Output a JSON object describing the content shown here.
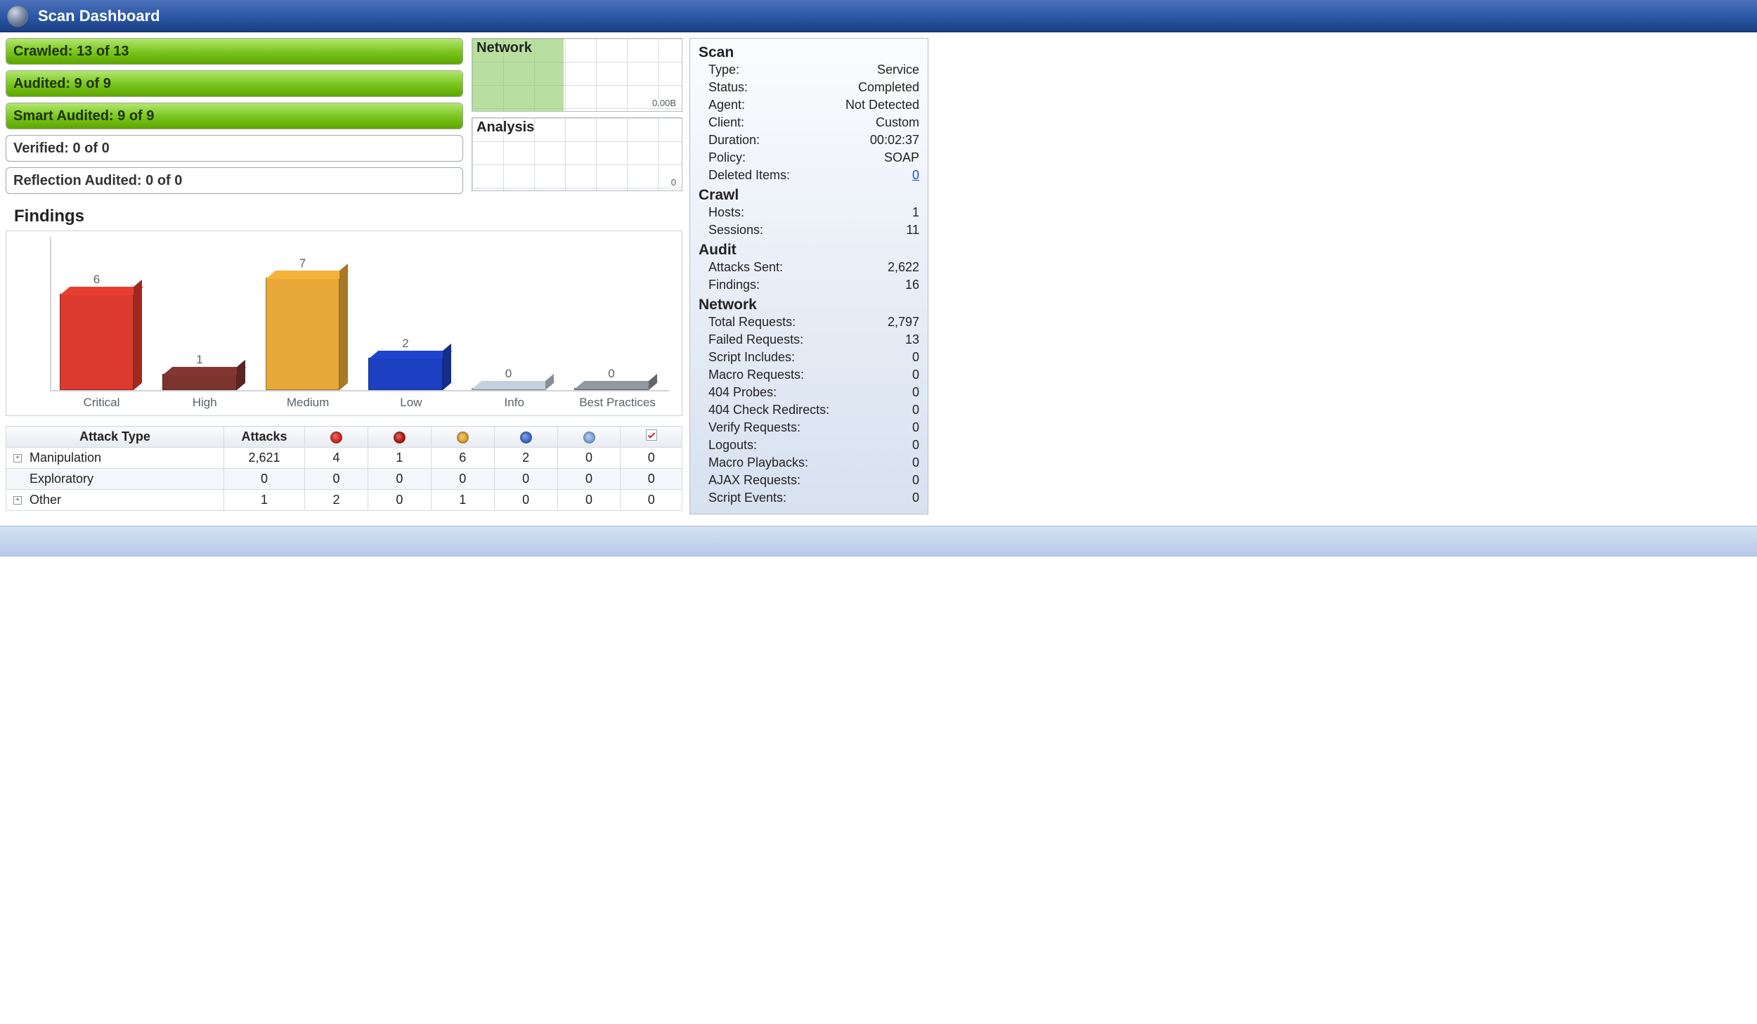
{
  "header": {
    "title": "Scan Dashboard"
  },
  "progress": {
    "crawled": {
      "label": "Crawled: 13 of 13",
      "pct": 100,
      "green": true
    },
    "audited": {
      "label": "Audited: 9 of 9",
      "pct": 100,
      "green": true
    },
    "smart": {
      "label": "Smart Audited: 9 of 9",
      "pct": 100,
      "green": true
    },
    "verified": {
      "label": "Verified: 0 of 0",
      "pct": 0,
      "green": false
    },
    "reflect": {
      "label": "Reflection Audited: 0 of 0",
      "pct": 0,
      "green": false
    }
  },
  "mini": {
    "network": {
      "title": "Network",
      "note": "0.00B"
    },
    "analysis": {
      "title": "Analysis",
      "note": "0"
    }
  },
  "findings_title": "Findings",
  "chart_data": {
    "type": "bar",
    "categories": [
      "Critical",
      "High",
      "Medium",
      "Low",
      "Info",
      "Best Practices"
    ],
    "values": [
      6,
      1,
      7,
      2,
      0,
      0
    ],
    "colors": [
      "#dc3a2f",
      "#7d342f",
      "#e8a838",
      "#1d3fc1",
      "#b9c4d1",
      "#888f97"
    ],
    "title": "Findings",
    "ylim": [
      0,
      7
    ]
  },
  "attack_table": {
    "headers": [
      "Attack Type",
      "Attacks",
      "critical",
      "high",
      "medium",
      "low",
      "info",
      "bp"
    ],
    "rows": [
      {
        "expand": true,
        "name": "Manipulation",
        "attacks": "2,621",
        "c": "4",
        "h": "1",
        "m": "6",
        "l": "2",
        "i": "0",
        "bp": "0"
      },
      {
        "expand": false,
        "name": "Exploratory",
        "attacks": "0",
        "c": "0",
        "h": "0",
        "m": "0",
        "l": "0",
        "i": "0",
        "bp": "0"
      },
      {
        "expand": true,
        "name": "Other",
        "attacks": "1",
        "c": "2",
        "h": "0",
        "m": "1",
        "l": "0",
        "i": "0",
        "bp": "0"
      }
    ]
  },
  "info": {
    "scan": {
      "heading": "Scan",
      "type_label": "Type:",
      "type_value": "Service",
      "status_label": "Status:",
      "status_value": "Completed",
      "agent_label": "Agent:",
      "agent_value": "Not Detected",
      "client_label": "Client:",
      "client_value": "Custom",
      "duration_label": "Duration:",
      "duration_value": "00:02:37",
      "policy_label": "Policy:",
      "policy_value": "SOAP",
      "deleted_label": "Deleted Items:",
      "deleted_value": "0"
    },
    "crawl": {
      "heading": "Crawl",
      "hosts_label": "Hosts:",
      "hosts_value": "1",
      "sessions_label": "Sessions:",
      "sessions_value": "11"
    },
    "audit": {
      "heading": "Audit",
      "sent_label": "Attacks Sent:",
      "sent_value": "2,622",
      "findings_label": "Findings:",
      "findings_value": "16"
    },
    "net": {
      "heading": "Network",
      "total_label": "Total Requests:",
      "total_value": "2,797",
      "failed_label": "Failed Requests:",
      "failed_value": "13",
      "scriptinc_label": "Script Includes:",
      "scriptinc_value": "0",
      "macro_label": "Macro Requests:",
      "macro_value": "0",
      "p404_label": "404 Probes:",
      "p404_value": "0",
      "c404_label": "404 Check Redirects:",
      "c404_value": "0",
      "verify_label": "Verify Requests:",
      "verify_value": "0",
      "logout_label": "Logouts:",
      "logout_value": "0",
      "play_label": "Macro Playbacks:",
      "play_value": "0",
      "ajax_label": "AJAX Requests:",
      "ajax_value": "0",
      "sevt_label": "Script Events:",
      "sevt_value": "0"
    }
  }
}
